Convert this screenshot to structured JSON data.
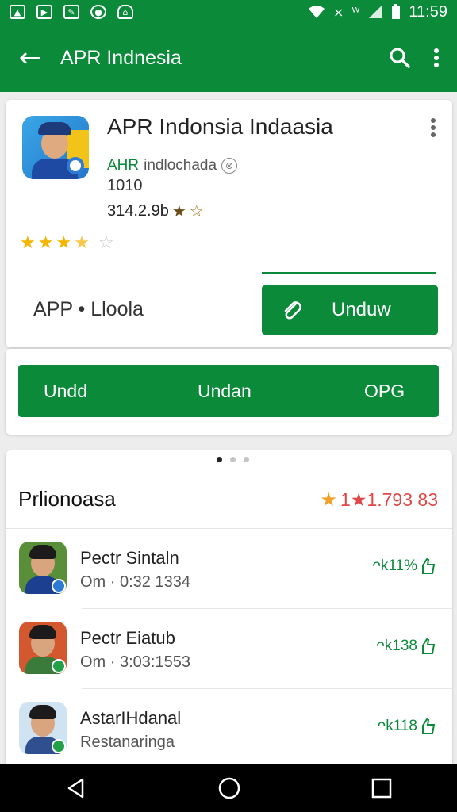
{
  "status_bar": {
    "time": "11:59",
    "left_icons": [
      "image-icon",
      "play-icon",
      "edit-icon",
      "record-icon",
      "home-icon"
    ],
    "right_icons": [
      "wifi-icon",
      "signal-off-icon",
      "wifi-calling-icon",
      "cellular-icon",
      "battery-icon"
    ]
  },
  "app_bar": {
    "title": "APR Indnesia",
    "back_icon": "arrow-left-icon",
    "search_icon": "search-icon",
    "menu_icon": "more-vert-icon"
  },
  "app_card": {
    "title": "APR Indonsia Indaasia",
    "developer_green": "AHR",
    "developer_grey": "indlochada",
    "info_icon": "info-icon",
    "count_line": "1010",
    "rating_line": "314.2.9b",
    "rating_line_stars": [
      "★",
      "☆"
    ],
    "star_rating": 3.5,
    "star_glyphs": {
      "full": "★",
      "empty": "☆"
    },
    "package_label": "APP • Lloola",
    "install_button": "Unduw"
  },
  "action_card": {
    "buttons": [
      "Undd",
      "Undan",
      "OPG"
    ]
  },
  "reviews_section": {
    "carousel_active_index": 0,
    "carousel_count": 3,
    "title": "Prlionoasa",
    "rating_star": "★",
    "rating_text": "1★1.793 83",
    "items": [
      {
        "name": "Pectr Sintaln",
        "subtitle": "Om  ·  0:32 1334",
        "right": "ᴖk11%",
        "avatar_bg": "#5a8f3a",
        "avatar_shirt": "#1d3f8f",
        "badge": "#2e7bd6"
      },
      {
        "name": "Pectr Eiatub",
        "subtitle": "Om  ·  3:03:1553",
        "right": "ᴖk138",
        "avatar_bg": "#d4582f",
        "avatar_shirt": "#3a7a3a",
        "badge": "#23a14a"
      },
      {
        "name": "AstarIHdanal",
        "subtitle": "Restanaringa",
        "right": "ᴖk118",
        "avatar_bg": "#cfe3f2",
        "avatar_shirt": "#2f4f8f",
        "badge": "#23a14a"
      }
    ]
  },
  "nav_bar": {
    "icons": [
      "back-triangle-icon",
      "home-circle-icon",
      "recents-square-icon"
    ]
  },
  "colors": {
    "primary": "#0b8a3a",
    "rating_text": "#e04848",
    "star": "#f4b400"
  }
}
